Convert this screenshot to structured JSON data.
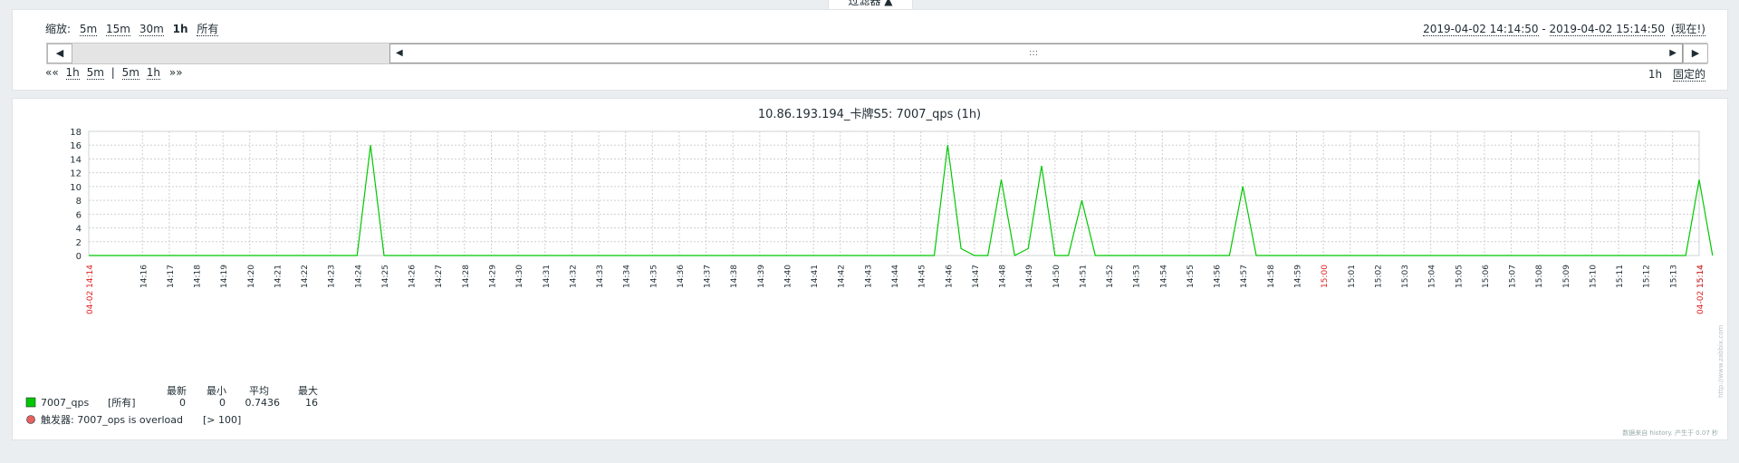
{
  "filter": {
    "tab_label": "过滤器 ▲",
    "zoom_label": "缩放:",
    "zoom_options": [
      "5m",
      "15m",
      "30m",
      "1h",
      "所有"
    ],
    "selected_zoom": "1h",
    "range_from": "2019-04-02 14:14:50",
    "range_sep": " - ",
    "range_to": "2019-04-02 15:14:50",
    "now_label": "(现在!)",
    "nav_back": "««",
    "nav_back_options": [
      "1h",
      "5m"
    ],
    "nav_divider": "|",
    "nav_forward_options": [
      "5m",
      "1h"
    ],
    "nav_forward": "»»",
    "period": "1h",
    "fixed_label": "固定的",
    "scroll_left": "◀",
    "scroll_right": "▶",
    "bar_left": "◀",
    "bar_handle": ":::",
    "bar_right": "▶"
  },
  "chart_data": {
    "type": "line",
    "title": "10.86.193.194_卡牌S5: 7007_qps (1h)",
    "ylim": [
      0,
      18
    ],
    "yticks": [
      0,
      2,
      4,
      6,
      8,
      10,
      12,
      14,
      16,
      18
    ],
    "grid": true,
    "xlim": [
      "14:14",
      "15:14"
    ],
    "edge_labels": [
      "04-02 14:14",
      "04-02 15:14"
    ],
    "x_tick_labels": [
      "14:16",
      "14:17",
      "14:18",
      "14:19",
      "14:20",
      "14:21",
      "14:22",
      "14:23",
      "14:24",
      "14:25",
      "14:26",
      "14:27",
      "14:28",
      "14:29",
      "14:30",
      "14:31",
      "14:32",
      "14:33",
      "14:34",
      "14:35",
      "14:36",
      "14:37",
      "14:38",
      "14:39",
      "14:40",
      "14:41",
      "14:42",
      "14:43",
      "14:44",
      "14:45",
      "14:46",
      "14:47",
      "14:48",
      "14:49",
      "14:50",
      "14:51",
      "14:52",
      "14:53",
      "14:54",
      "14:55",
      "14:56",
      "14:57",
      "14:58",
      "14:59",
      "15:00",
      "15:01",
      "15:02",
      "15:03",
      "15:04",
      "15:05",
      "15:06",
      "15:07",
      "15:08",
      "15:09",
      "15:10",
      "15:11",
      "15:12",
      "15:13",
      "15:14"
    ],
    "highlight_label": "15:00",
    "highlight_color": "#e02020",
    "series": [
      {
        "name": "7007_qps",
        "color": "#00c800",
        "points": [
          [
            "14:14",
            0
          ],
          [
            "14:24",
            0
          ],
          [
            "14:24.5",
            16
          ],
          [
            "14:25",
            0
          ],
          [
            "14:45.5",
            0
          ],
          [
            "14:46",
            16
          ],
          [
            "14:46.5",
            1
          ],
          [
            "14:47",
            0
          ],
          [
            "14:47.5",
            0
          ],
          [
            "14:48",
            11
          ],
          [
            "14:48.5",
            0
          ],
          [
            "14:49",
            1
          ],
          [
            "14:49.5",
            13
          ],
          [
            "14:50",
            0
          ],
          [
            "14:50.5",
            0
          ],
          [
            "14:51",
            8
          ],
          [
            "14:51.5",
            0
          ],
          [
            "14:56.5",
            0
          ],
          [
            "14:57",
            10
          ],
          [
            "14:57.5",
            0
          ],
          [
            "15:13.5",
            0
          ],
          [
            "15:14",
            11
          ],
          [
            "15:14.5",
            0
          ]
        ]
      }
    ],
    "legend": {
      "headers": [
        "最新",
        "最小",
        "平均",
        "最大"
      ],
      "rows": [
        {
          "name": "7007_qps",
          "func": "[所有]",
          "values": [
            "0",
            "0",
            "0.7436",
            "16"
          ],
          "color": "#00c800"
        }
      ],
      "trigger": {
        "label": "触发器: 7007_ops is overload",
        "condition": "[> 100]",
        "color": "#e86060"
      }
    },
    "watermark": "http://www.zabbix.com",
    "footer": "数据来自 history. 产生于 0.07 秒"
  }
}
